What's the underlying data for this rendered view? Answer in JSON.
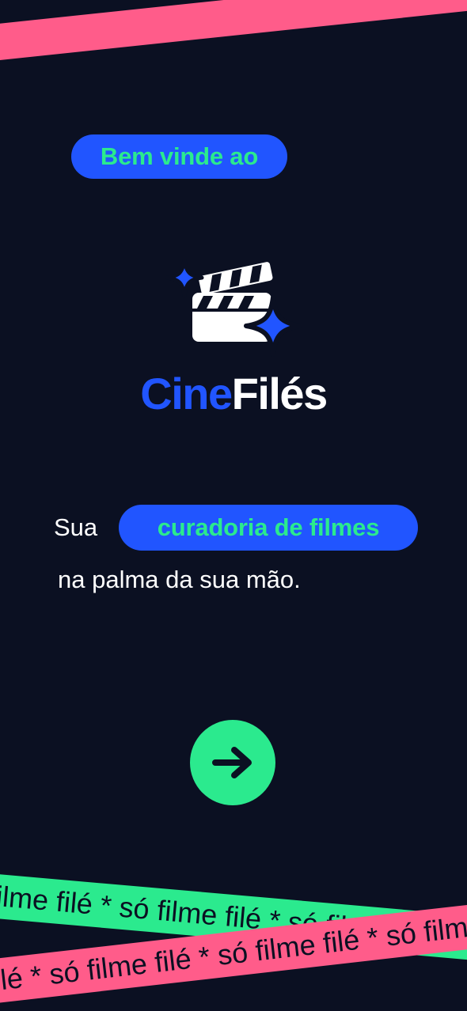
{
  "welcome": {
    "label": "Bem vinde ao"
  },
  "brand": {
    "part1": "Cine",
    "part2": "Filés",
    "icon": "clapperboard-sparkles-icon"
  },
  "tagline": {
    "prefix": "Sua",
    "highlight": "curadoria de filmes",
    "line2": "na palma da sua mão."
  },
  "next_button": {
    "icon": "arrow-right-icon"
  },
  "marquee": {
    "green_text": "filme filé * só filme filé * só filme filé * só filme filé",
    "pink_text": "e filé * só filme filé * só filme filé * só filme filé"
  },
  "colors": {
    "background": "#0B1022",
    "accent_blue": "#2155FF",
    "accent_green": "#2BEA8E",
    "accent_pink": "#FF5C8A",
    "white": "#FFFFFF"
  }
}
